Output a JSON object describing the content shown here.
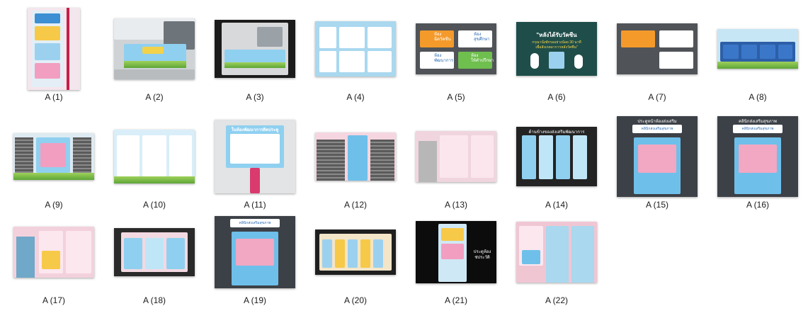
{
  "window": {
    "title": ""
  },
  "items": [
    {
      "label": "A (1)"
    },
    {
      "label": "A (2)"
    },
    {
      "label": "A (3)"
    },
    {
      "label": "A (4)"
    },
    {
      "label": "A (5)"
    },
    {
      "label": "A (6)"
    },
    {
      "label": "A (7)"
    },
    {
      "label": "A (8)"
    },
    {
      "label": "A (9)"
    },
    {
      "label": "A (10)"
    },
    {
      "label": "A (11)"
    },
    {
      "label": "A (12)"
    },
    {
      "label": "A (13)"
    },
    {
      "label": "A (14)"
    },
    {
      "label": "A (15)"
    },
    {
      "label": "A (16)"
    },
    {
      "label": "A (17)"
    },
    {
      "label": "A (18)"
    },
    {
      "label": "A (19)"
    },
    {
      "label": "A (20)"
    },
    {
      "label": "A (21)"
    },
    {
      "label": "A (22)"
    }
  ],
  "thumb_text": {
    "a5": [
      "ห้อง",
      "ฉีดวัคซีน",
      "ห้อง",
      "สุขศึกษา",
      "ห้อง",
      "พัฒนาการ",
      "ห้อง",
      "ให้คำปรึกษา"
    ],
    "a6": [
      "\"หลังได้รับวัคซีน",
      "กรุณานั่งพักรออย่างน้อย 30 นาที",
      "เพื่อสังเกตอาการหลังวัคซีน\""
    ],
    "a21": [
      "ประตูห้อง",
      "ช่ประวัติ"
    ],
    "a15": [
      "ประตูหน้าห้องส่งเสริม",
      "คลินิกส่งเสริมสุขภาพ"
    ],
    "a16": [
      "คลินิกส่งเสริมสุขภาพ",
      "คลินิกส่งเสริมสุขภาพ"
    ],
    "a19": [
      "คลินิกส่งเสริมสุขภาพ"
    ],
    "a11": [
      "ในห้องพัฒนาการติดประตู"
    ],
    "a14": [
      "ด้านข้างของส่งเสริมพัฒนาการ"
    ]
  }
}
